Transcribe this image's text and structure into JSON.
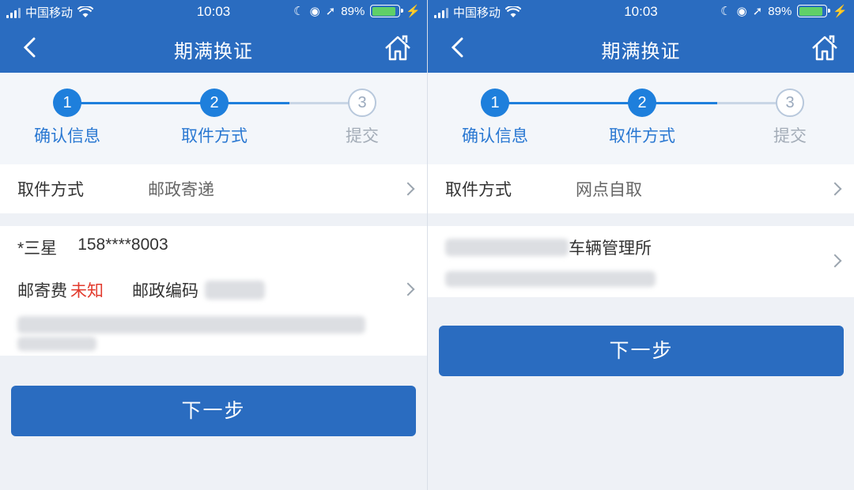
{
  "status": {
    "carrier": "中国移动",
    "time": "10:03",
    "battery": "89%",
    "battery_level": 0.89
  },
  "nav": {
    "title": "期满换证"
  },
  "steps": [
    {
      "num": "1",
      "label": "确认信息"
    },
    {
      "num": "2",
      "label": "取件方式"
    },
    {
      "num": "3",
      "label": "提交"
    }
  ],
  "left": {
    "method_label": "取件方式",
    "method_value": "邮政寄递",
    "recipient_name": "*三星",
    "recipient_phone": "158****8003",
    "fee_label": "邮寄费",
    "fee_value": "未知",
    "postcode_label": "邮政编码",
    "next_button": "下一步"
  },
  "right": {
    "method_label": "取件方式",
    "method_value": "网点自取",
    "site_name_suffix": "车辆管理所",
    "next_button": "下一步"
  },
  "colors": {
    "brand_blue": "#2a6cc0",
    "step_active": "#1e7fdc",
    "fee_red": "#e23b2e",
    "battery_green": "#5fd068"
  }
}
